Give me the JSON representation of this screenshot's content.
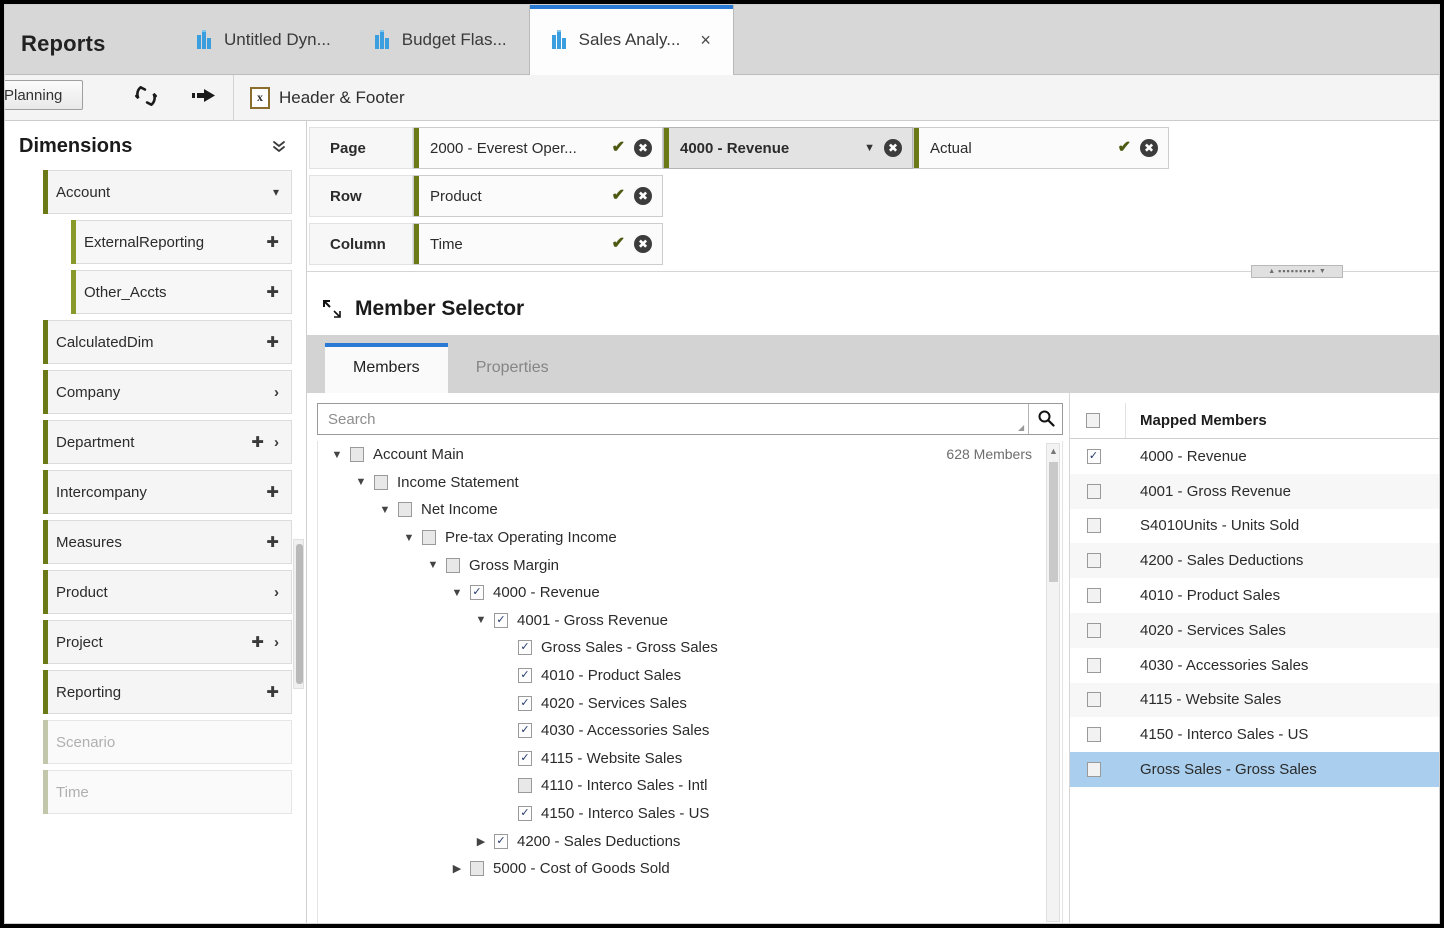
{
  "window": {
    "app_title": "Reports"
  },
  "tabs": [
    {
      "label": "Untitled Dyn...",
      "icon": "chart-tab-icon",
      "active": false,
      "closable": false
    },
    {
      "label": "Budget Flas...",
      "icon": "chart-tab-icon",
      "active": false,
      "closable": false
    },
    {
      "label": "Sales Analy...",
      "icon": "chart-tab-icon",
      "active": true,
      "closable": true,
      "close_label": "×"
    }
  ],
  "toolbar": {
    "planning_label": "Planning",
    "refresh_icon": "refresh-icon",
    "run_icon": "run-arrow-icon",
    "header_footer_label": "Header & Footer",
    "header_footer_icon": "header-footer-icon",
    "header_footer_glyph": "x"
  },
  "sidebar": {
    "title": "Dimensions",
    "collapse_icon": "chevron-double-down-icon",
    "items": [
      {
        "label": "Account",
        "level": 0,
        "ops": [
          "caret-down"
        ],
        "disabled": false
      },
      {
        "label": "ExternalReporting",
        "level": 1,
        "ops": [
          "move"
        ],
        "disabled": false
      },
      {
        "label": "Other_Accts",
        "level": 1,
        "ops": [
          "move"
        ],
        "disabled": false
      },
      {
        "label": "CalculatedDim",
        "level": 0,
        "ops": [
          "move"
        ],
        "disabled": false
      },
      {
        "label": "Company",
        "level": 0,
        "ops": [
          "chevron-right"
        ],
        "disabled": false
      },
      {
        "label": "Department",
        "level": 0,
        "ops": [
          "move",
          "chevron-right"
        ],
        "disabled": false
      },
      {
        "label": "Intercompany",
        "level": 0,
        "ops": [
          "move"
        ],
        "disabled": false
      },
      {
        "label": "Measures",
        "level": 0,
        "ops": [
          "move"
        ],
        "disabled": false
      },
      {
        "label": "Product",
        "level": 0,
        "ops": [
          "chevron-right"
        ],
        "disabled": false
      },
      {
        "label": "Project",
        "level": 0,
        "ops": [
          "move",
          "chevron-right"
        ],
        "disabled": false
      },
      {
        "label": "Reporting",
        "level": 0,
        "ops": [
          "move"
        ],
        "disabled": false
      },
      {
        "label": "Scenario",
        "level": 0,
        "ops": [],
        "disabled": true
      },
      {
        "label": "Time",
        "level": 0,
        "ops": [],
        "disabled": true
      }
    ]
  },
  "pov": {
    "rows": [
      {
        "label": "Page",
        "fields": [
          {
            "value": "2000 - Everest Oper...",
            "selected": false,
            "ops": [
              "check",
              "clear"
            ]
          },
          {
            "value": "4000 - Revenue",
            "selected": true,
            "ops": [
              "caret",
              "clear"
            ]
          },
          {
            "value": "Actual",
            "selected": false,
            "ops": [
              "check",
              "clear"
            ]
          }
        ]
      },
      {
        "label": "Row",
        "fields": [
          {
            "value": "Product",
            "selected": false,
            "ops": [
              "check",
              "clear"
            ]
          }
        ]
      },
      {
        "label": "Column",
        "fields": [
          {
            "value": "Time",
            "selected": false,
            "ops": [
              "check",
              "clear"
            ]
          }
        ]
      }
    ]
  },
  "splitter": {
    "icon": "splitter-grip-icon",
    "dots": "▪▪▪▪▪▪▪▪▪"
  },
  "member_selector": {
    "title": "Member Selector",
    "restore_icon": "restore-window-icon",
    "tabs": [
      {
        "label": "Members",
        "active": true
      },
      {
        "label": "Properties",
        "active": false
      }
    ],
    "search": {
      "placeholder": "Search",
      "value": "",
      "icon": "search-icon"
    },
    "tree": {
      "member_count_label": "628 Members",
      "scroll_up_icon": "scroll-up-arrow-icon",
      "nodes": [
        {
          "label": "Account Main",
          "depth": 0,
          "twisty": "down",
          "checked": "none"
        },
        {
          "label": "Income Statement",
          "depth": 1,
          "twisty": "down",
          "checked": "none"
        },
        {
          "label": "Net Income",
          "depth": 2,
          "twisty": "down",
          "checked": "none"
        },
        {
          "label": "Pre-tax Operating Income",
          "depth": 3,
          "twisty": "down",
          "checked": "none"
        },
        {
          "label": "Gross Margin",
          "depth": 4,
          "twisty": "down",
          "checked": "none"
        },
        {
          "label": "4000 - Revenue",
          "depth": 5,
          "twisty": "down",
          "checked": "on"
        },
        {
          "label": "4001 - Gross Revenue",
          "depth": 6,
          "twisty": "down",
          "checked": "on"
        },
        {
          "label": "Gross Sales - Gross Sales",
          "depth": 7,
          "twisty": "none",
          "checked": "on"
        },
        {
          "label": "4010 - Product Sales",
          "depth": 7,
          "twisty": "none",
          "checked": "on"
        },
        {
          "label": "4020 - Services Sales",
          "depth": 7,
          "twisty": "none",
          "checked": "on"
        },
        {
          "label": "4030 - Accessories Sales",
          "depth": 7,
          "twisty": "none",
          "checked": "on"
        },
        {
          "label": "4115 - Website Sales",
          "depth": 7,
          "twisty": "none",
          "checked": "on"
        },
        {
          "label": "4110 - Interco Sales - Intl",
          "depth": 7,
          "twisty": "none",
          "checked": "none"
        },
        {
          "label": "4150 - Interco Sales - US",
          "depth": 7,
          "twisty": "none",
          "checked": "on"
        },
        {
          "label": "4200 - Sales Deductions",
          "depth": 6,
          "twisty": "right",
          "checked": "on"
        },
        {
          "label": "5000 - Cost of Goods Sold",
          "depth": 5,
          "twisty": "right",
          "checked": "none"
        }
      ]
    },
    "mapped_members": {
      "header": "Mapped Members",
      "select_all_checked": false,
      "rows": [
        {
          "label": "4000 - Revenue",
          "checked": true,
          "selected": false
        },
        {
          "label": "4001 - Gross Revenue",
          "checked": false,
          "selected": false
        },
        {
          "label": "S4010Units - Units Sold",
          "checked": false,
          "selected": false
        },
        {
          "label": "4200 - Sales Deductions",
          "checked": false,
          "selected": false
        },
        {
          "label": "4010 - Product Sales",
          "checked": false,
          "selected": false
        },
        {
          "label": "4020 - Services Sales",
          "checked": false,
          "selected": false
        },
        {
          "label": "4030 - Accessories Sales",
          "checked": false,
          "selected": false
        },
        {
          "label": "4115 - Website Sales",
          "checked": false,
          "selected": false
        },
        {
          "label": "4150 - Interco Sales - US",
          "checked": false,
          "selected": false
        },
        {
          "label": "Gross Sales - Gross Sales",
          "checked": false,
          "selected": true
        }
      ]
    }
  },
  "colors": {
    "tab_accent": "#2a79d2",
    "dimension_accent": "#6b7a17",
    "selection_blue": "#aacfee",
    "tab_icon_blue": "#3b9ede"
  }
}
